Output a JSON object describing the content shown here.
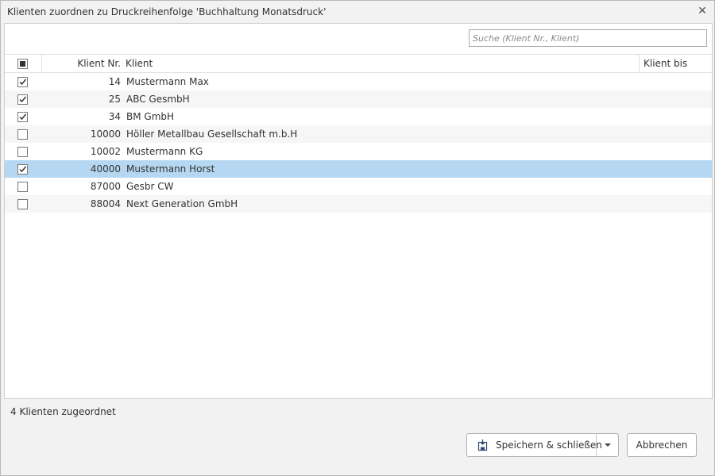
{
  "dialog": {
    "title": "Klienten zuordnen zu Druckreihenfolge 'Buchhaltung Monatsdruck'",
    "close_icon": "close-icon"
  },
  "search": {
    "placeholder": "Suche (Klient Nr., Klient)",
    "value": ""
  },
  "grid": {
    "columns": {
      "nr": "Klient Nr.",
      "client": "Klient",
      "client_bis": "Klient bis"
    },
    "rows": [
      {
        "checked": true,
        "nr": "14",
        "client": "Mustermann Max",
        "selected": false
      },
      {
        "checked": true,
        "nr": "25",
        "client": "ABC GesmbH",
        "selected": false
      },
      {
        "checked": true,
        "nr": "34",
        "client": "BM GmbH",
        "selected": false
      },
      {
        "checked": false,
        "nr": "10000",
        "client": "Höller Metallbau Gesellschaft m.b.H",
        "selected": false
      },
      {
        "checked": false,
        "nr": "10002",
        "client": "Mustermann KG",
        "selected": false
      },
      {
        "checked": true,
        "nr": "40000",
        "client": "Mustermann Horst",
        "selected": true
      },
      {
        "checked": false,
        "nr": "87000",
        "client": "Gesbr CW",
        "selected": false
      },
      {
        "checked": false,
        "nr": "88004",
        "client": "Next Generation GmbH",
        "selected": false
      }
    ]
  },
  "footer": {
    "status": "4 Klienten zugeordnet",
    "save_label": "Speichern & schließen",
    "cancel_label": "Abbrechen"
  },
  "colors": {
    "selected_row": "#b5d7f1",
    "alt_row": "#f6f6f6",
    "dialog_bg": "#f2f2f2"
  }
}
